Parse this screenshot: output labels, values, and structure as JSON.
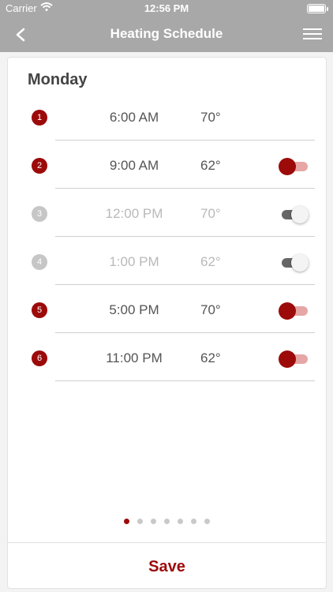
{
  "status_bar": {
    "carrier": "Carrier",
    "time": "12:56 PM"
  },
  "nav": {
    "title": "Heating Schedule",
    "back_icon": "chevron-left-icon",
    "menu_icon": "hamburger-menu-icon"
  },
  "day": "Monday",
  "colors": {
    "accent": "#9c0a0a",
    "header": "#a8a8a8",
    "inactive": "#c6c6c6"
  },
  "schedule": [
    {
      "index": "1",
      "time": "6:00 AM",
      "temp": "70°",
      "enabled": true,
      "has_toggle": false
    },
    {
      "index": "2",
      "time": "9:00 AM",
      "temp": "62°",
      "enabled": true,
      "has_toggle": true
    },
    {
      "index": "3",
      "time": "12:00 PM",
      "temp": "70°",
      "enabled": false,
      "has_toggle": true
    },
    {
      "index": "4",
      "time": "1:00 PM",
      "temp": "62°",
      "enabled": false,
      "has_toggle": true
    },
    {
      "index": "5",
      "time": "5:00 PM",
      "temp": "70°",
      "enabled": true,
      "has_toggle": true
    },
    {
      "index": "6",
      "time": "11:00 PM",
      "temp": "62°",
      "enabled": true,
      "has_toggle": true
    }
  ],
  "pager": {
    "count": 7,
    "active": 0
  },
  "save_label": "Save"
}
